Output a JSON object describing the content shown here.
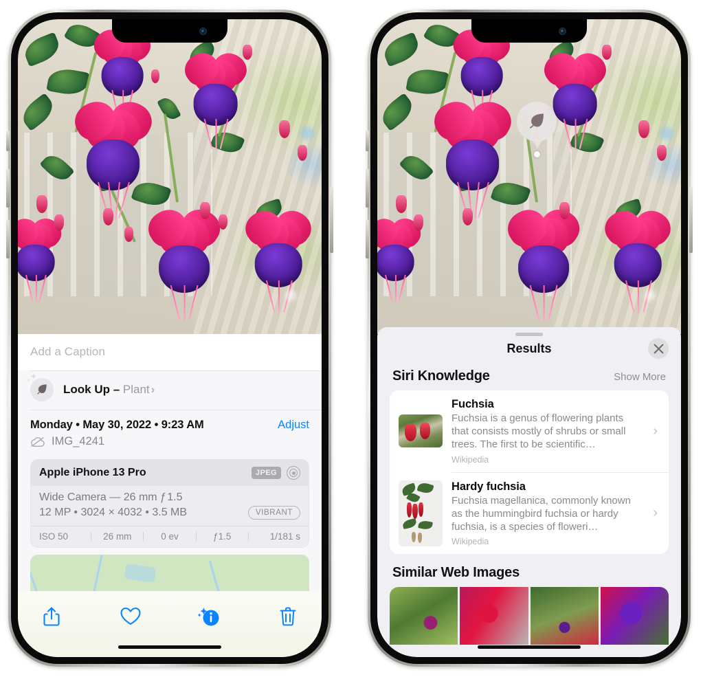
{
  "left_phone": {
    "caption_input": {
      "placeholder": "Add a Caption",
      "value": ""
    },
    "lookup_row": {
      "icon": "leaf-icon",
      "sparkle_icon": "sparkle-icon",
      "label": "Look Up –",
      "subject": "Plant",
      "chevron": "›"
    },
    "metadata": {
      "date": "Monday • May 30, 2022 • 9:23 AM",
      "adjust_label": "Adjust",
      "cloud_icon": "icloud-slash-icon",
      "filename": "IMG_4241"
    },
    "exif": {
      "device": "Apple iPhone 13 Pro",
      "format_badge": "JPEG",
      "lens_icon": "lens-icon",
      "lens_line": "Wide Camera — 26 mm ƒ 1.5",
      "size_line": "12 MP • 3024 × 4032 • 3.5 MB",
      "style_badge": "VIBRANT",
      "settings": [
        "ISO 50",
        "26 mm",
        "0 ev",
        "ƒ1.5",
        "1/181 s"
      ]
    },
    "map": {
      "pin_label": "photo-location-pin"
    },
    "toolbar": [
      {
        "name": "share-button",
        "icon": "share-icon"
      },
      {
        "name": "favorite-button",
        "icon": "heart-icon"
      },
      {
        "name": "info-button",
        "icon": "info-sparkle-icon"
      },
      {
        "name": "delete-button",
        "icon": "trash-icon"
      }
    ],
    "accent_color": "#0a84ff"
  },
  "right_phone": {
    "vlu_badge": {
      "icon": "leaf-icon",
      "tooltip": "visual-look-up-plant"
    },
    "sheet": {
      "grabber": "drag-handle",
      "title": "Results",
      "close_icon": "close-icon"
    },
    "siri_knowledge": {
      "title": "Siri Knowledge",
      "action": "Show More",
      "cards": [
        {
          "title": "Fuchsia",
          "description": "Fuchsia is a genus of flowering plants that consists mostly of shrubs or small trees. The first to be scientific…",
          "source": "Wikipedia",
          "thumb": "fuchsia-thumbnail",
          "chevron": "›"
        },
        {
          "title": "Hardy fuchsia",
          "description": "Fuchsia magellanica, commonly known as the hummingbird fuchsia or hardy fuchsia, is a species of floweri…",
          "source": "Wikipedia",
          "thumb": "hardy-fuchsia-thumbnail",
          "chevron": "›"
        }
      ]
    },
    "similar_web_images": {
      "title": "Similar Web Images",
      "tiles": [
        "web-image-1",
        "web-image-2",
        "web-image-3",
        "web-image-4"
      ]
    }
  }
}
